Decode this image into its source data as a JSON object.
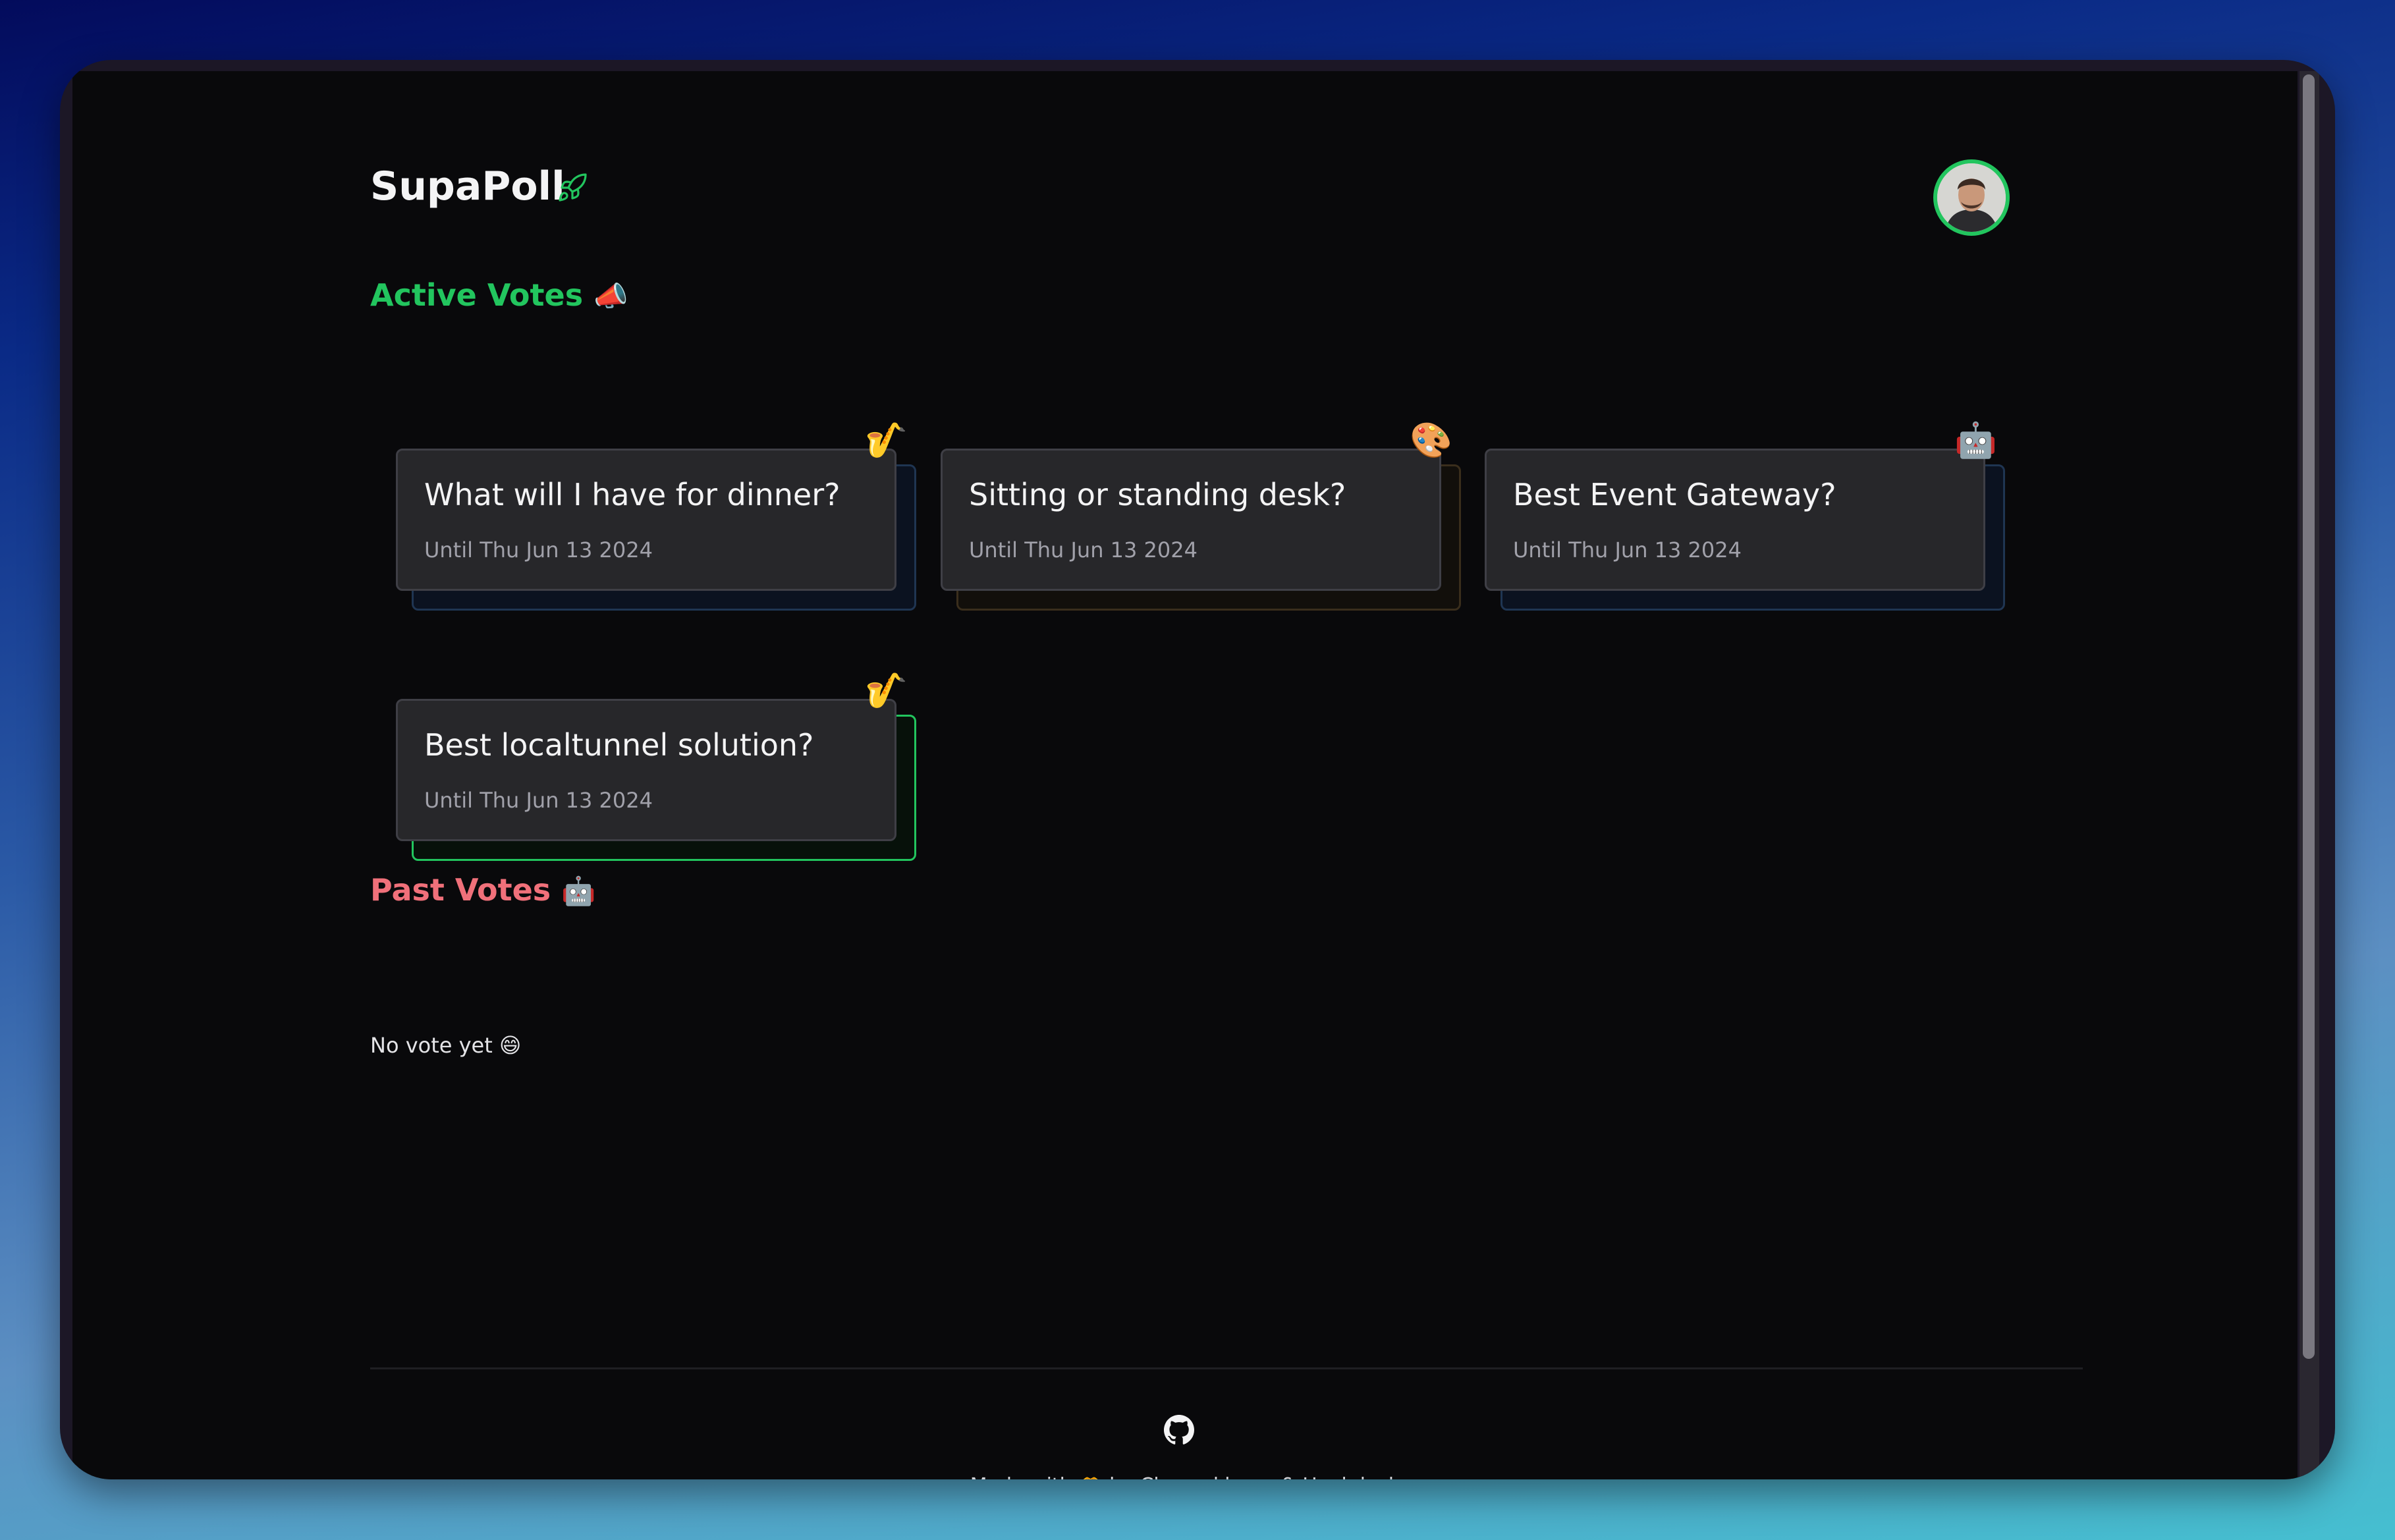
{
  "app": {
    "title": "SupaPoll",
    "title_icon": "rocket-icon"
  },
  "colors": {
    "accent_green": "#22c55e",
    "accent_red": "#f0707a",
    "card_bg": "#27272a",
    "page_bg": "#09090b"
  },
  "active_votes": {
    "heading": "Active Votes",
    "heading_icon": "megaphone-icon",
    "cards": [
      {
        "title": "What will I have for dinner?",
        "date": "Until Thu Jun 13 2024",
        "emoji": "🎷",
        "icon": "saxophone-icon"
      },
      {
        "title": "Sitting or standing desk?",
        "date": "Until Thu Jun 13 2024",
        "emoji": "🎨",
        "icon": "palette-icon"
      },
      {
        "title": "Best Event Gateway?",
        "date": "Until Thu Jun 13 2024",
        "emoji": "🤖",
        "icon": "robot-icon"
      },
      {
        "title": "Best localtunnel solution?",
        "date": "Until Thu Jun 13 2024",
        "emoji": "🎷",
        "icon": "saxophone-icon"
      }
    ]
  },
  "past_votes": {
    "heading": "Past Votes",
    "heading_icon": "robot-icon",
    "empty_text": "No vote yet",
    "empty_icon": "grinning-face-icon"
  },
  "footer": {
    "made_with": "Made with",
    "by_text": "by Chensokheng & Hookdeck",
    "github_icon": "github-icon",
    "heart_icon": "heart-hands-icon"
  }
}
